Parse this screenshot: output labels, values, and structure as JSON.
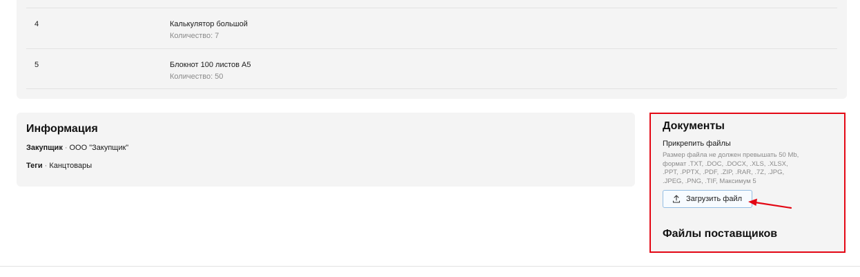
{
  "items": [
    {
      "number": "4",
      "name": "Калькулятор большой",
      "quantity": "Количество: 7"
    },
    {
      "number": "5",
      "name": "Блокнот 100 листов А5",
      "quantity": "Количество: 50"
    }
  ],
  "information": {
    "title": "Информация",
    "buyer_label": "Закупщик",
    "separator": "·",
    "buyer_value": "ООО \"Закупщик\"",
    "tags_label": "Теги",
    "tags_value": "Канцтовары"
  },
  "documents": {
    "title": "Документы",
    "attach_label": "Прикрепить файлы",
    "attach_hint": "Размер файла не должен превышать 50 Mb, формат .TXT, .DOC, .DOCX, .XLS, .XLSX, .PPT, .PPTX, .PDF, .ZIP, .RAR, .7Z, .JPG, .JPEG, .PNG, .TIF, Максимум 5",
    "upload_button": "Загрузить файл",
    "upload_icon": "upload-icon",
    "supplier_files_title": "Файлы поставщиков"
  },
  "colors": {
    "highlight": "#e30613",
    "card_background": "#f4f4f4",
    "button_border": "#93bde3"
  }
}
